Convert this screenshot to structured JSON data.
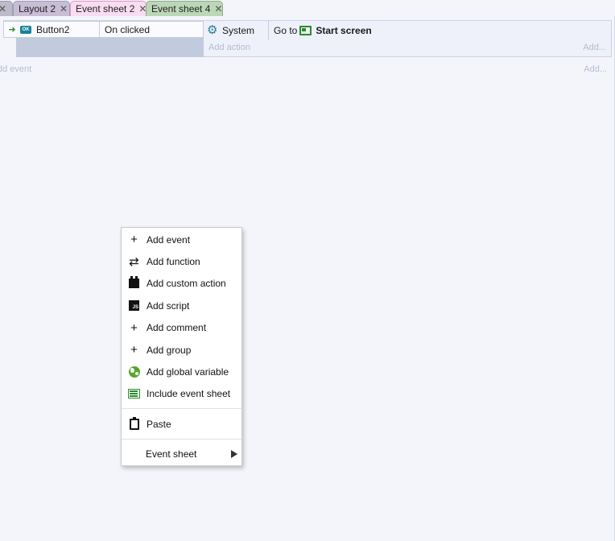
{
  "tabs": [
    {
      "label": "",
      "close": "✕"
    },
    {
      "label": "Layout 2",
      "close": "✕"
    },
    {
      "label": "Event sheet 2",
      "close": "✕"
    },
    {
      "label": "Event sheet 4",
      "close": "✕"
    }
  ],
  "event": {
    "condition": {
      "object_icon_text": "OK",
      "object": "Button2",
      "text": "On clicked"
    },
    "action": {
      "object": "System",
      "prefix": "Go to",
      "target": "Start screen"
    },
    "add_action": "Add action",
    "add_more": "Add..."
  },
  "sheet": {
    "add_event": "dd event",
    "add_more": "Add..."
  },
  "context_menu": {
    "items": [
      {
        "label": "Add event",
        "icon": "plus-icon"
      },
      {
        "label": "Add function",
        "icon": "function-icon"
      },
      {
        "label": "Add custom action",
        "icon": "custom-action-icon"
      },
      {
        "label": "Add script",
        "icon": "script-icon"
      },
      {
        "label": "Add comment",
        "icon": "plus-icon"
      },
      {
        "label": "Add group",
        "icon": "plus-icon"
      },
      {
        "label": "Add global variable",
        "icon": "globe-icon"
      },
      {
        "label": "Include event sheet",
        "icon": "event-sheet-icon"
      }
    ],
    "paste": {
      "label": "Paste",
      "icon": "clipboard-icon"
    },
    "submenu": {
      "label": "Event sheet",
      "icon": "chevron-right-icon"
    },
    "script_icon_text": "JS"
  },
  "colors": {
    "background": "#f4f5fb",
    "event_sheet_2_tab": "#f9dcf1",
    "event_sheet_4_tab": "#bcd7b8",
    "layout_tab": "#c9bdd6",
    "condition_selected": "#c2cadd",
    "system_icon": "#1f7f99",
    "layout_icon": "#2b8a2b",
    "globe_icon": "#55a630"
  }
}
